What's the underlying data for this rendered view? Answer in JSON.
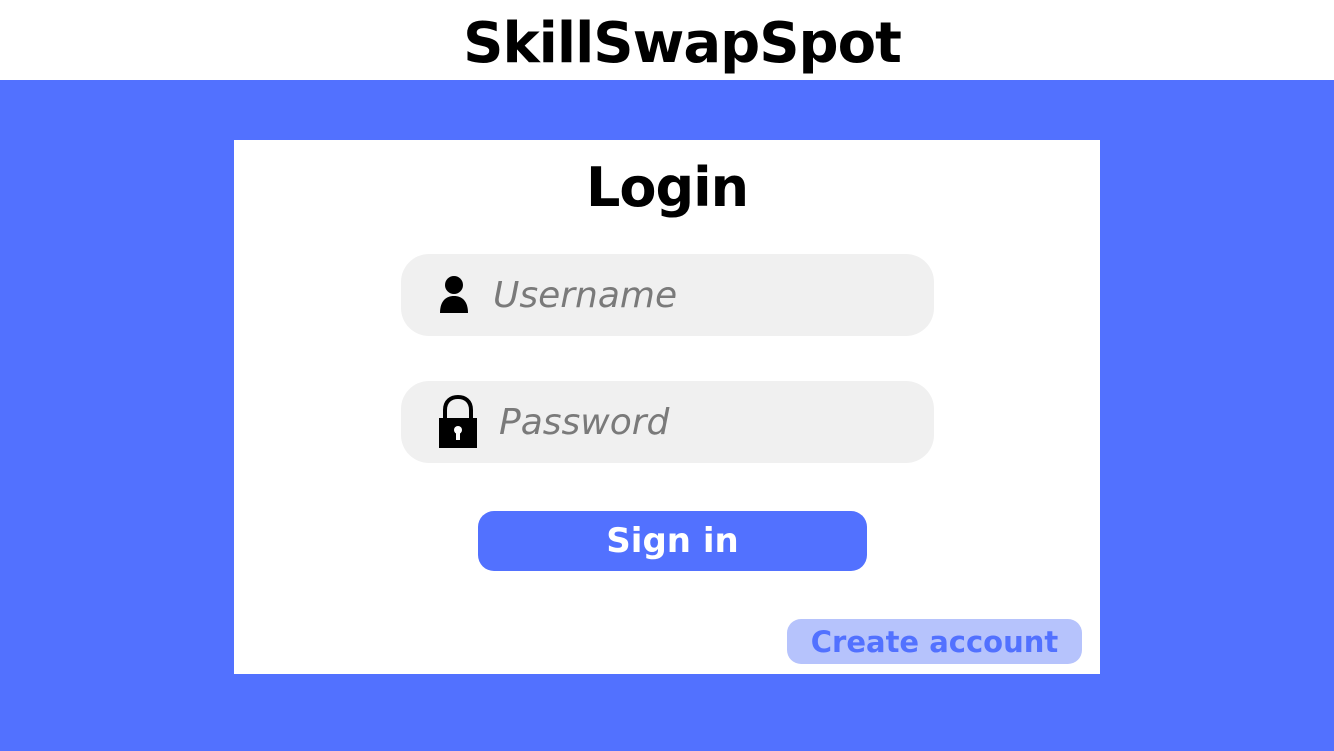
{
  "app": {
    "title": "SkillSwapSpot"
  },
  "login": {
    "title": "Login",
    "username": {
      "placeholder": "Username",
      "value": "",
      "icon": "user-icon"
    },
    "password": {
      "placeholder": "Password",
      "value": "",
      "icon": "lock-icon"
    },
    "signin_label": "Sign in",
    "create_account_label": "Create account"
  },
  "colors": {
    "accent": "#5271ff",
    "field_bg": "#f0f0f0",
    "secondary_button_bg": "#b6c3fc",
    "text": "#000000",
    "placeholder": "#7a7a7a"
  }
}
